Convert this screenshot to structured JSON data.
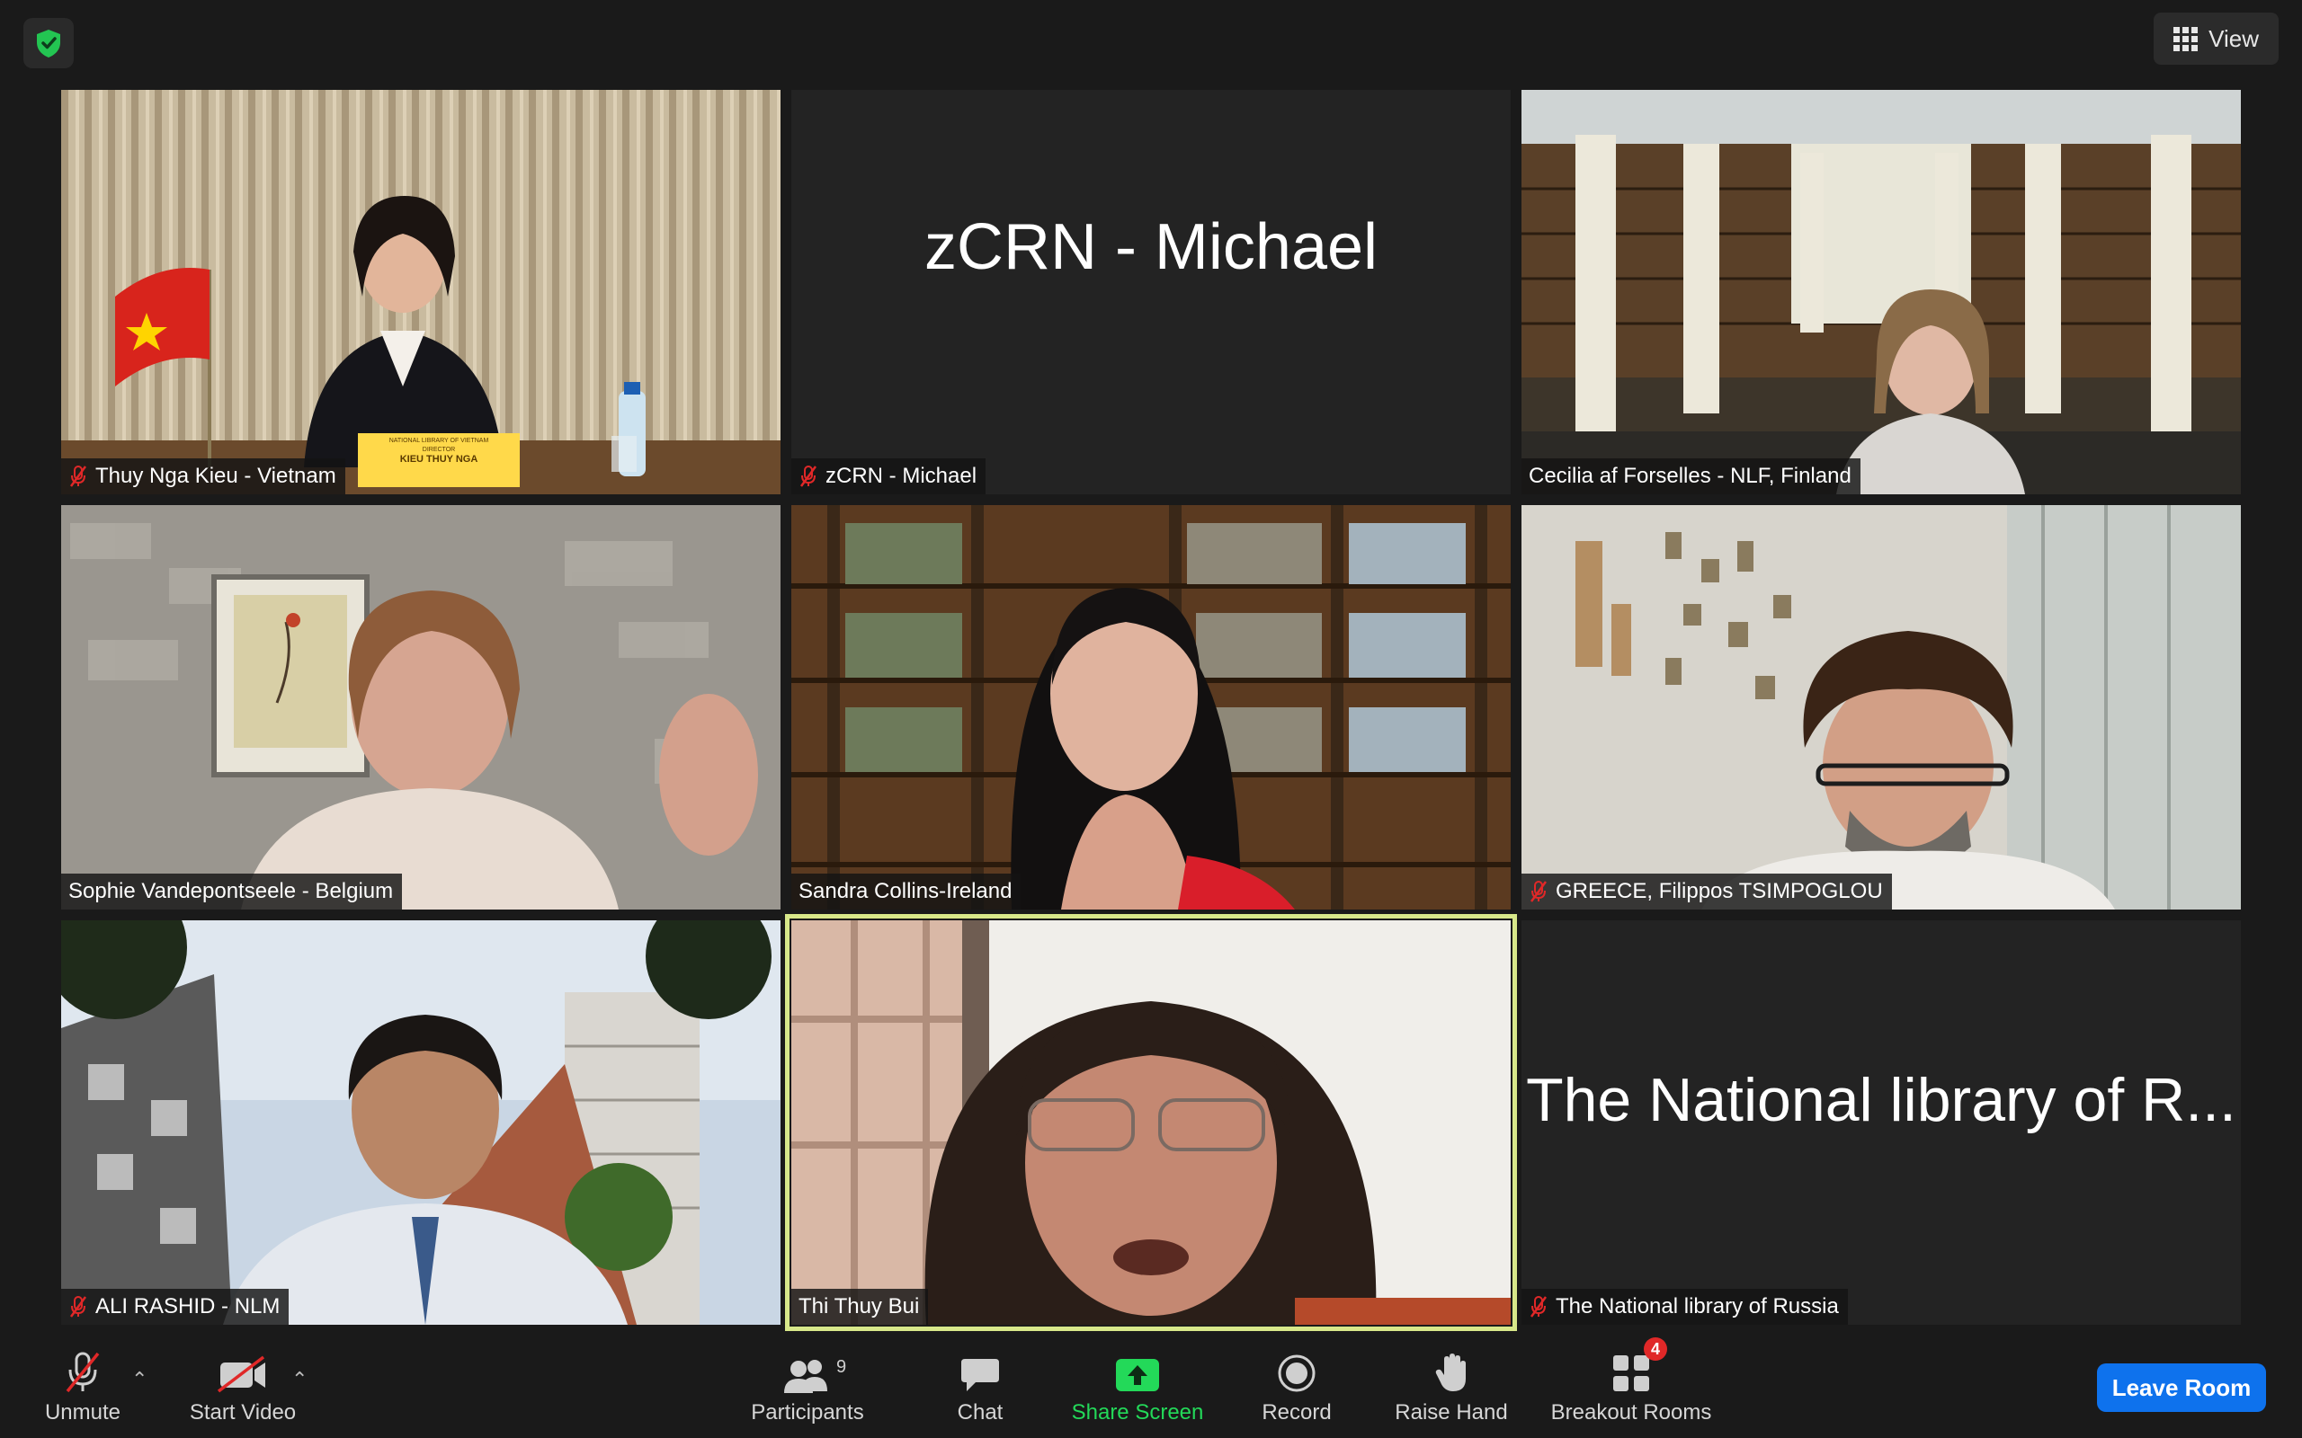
{
  "top_bar": {
    "view_label": "View"
  },
  "tiles": [
    {
      "name": "Thuy Nga Kieu - Vietnam",
      "muted": true,
      "placard_line1": "NATIONAL LIBRARY OF VIETNAM",
      "placard_line2": "DIRECTOR",
      "placard_line3": "KIEU THUY NGA"
    },
    {
      "name": "zCRN - Michael",
      "muted": true,
      "display_name": "zCRN - Michael"
    },
    {
      "name": "Cecilia af Forselles - NLF, Finland",
      "muted": false
    },
    {
      "name": "Sophie Vandepontseele - Belgium",
      "muted": false
    },
    {
      "name": "Sandra Collins-Ireland",
      "muted": false
    },
    {
      "name": "GREECE, Filippos TSIMPOGLOU",
      "muted": true
    },
    {
      "name": "ALI RASHID - NLM",
      "muted": true
    },
    {
      "name": "Thi Thuy Bui",
      "muted": false,
      "active_speaker": true
    },
    {
      "name": "The National library of Russia",
      "muted": true,
      "display_name": "The National library of R..."
    }
  ],
  "toolbar": {
    "unmute": "Unmute",
    "start_video": "Start Video",
    "participants": "Participants",
    "participants_count": "9",
    "chat": "Chat",
    "share_screen": "Share Screen",
    "record": "Record",
    "raise_hand": "Raise Hand",
    "breakout_rooms": "Breakout Rooms",
    "breakout_badge": "4",
    "leave_room": "Leave Room"
  },
  "colors": {
    "share_green": "#23d959",
    "leave_blue": "#0e72ed",
    "active_border": "#d8e88a",
    "muted_red": "#e02828"
  }
}
